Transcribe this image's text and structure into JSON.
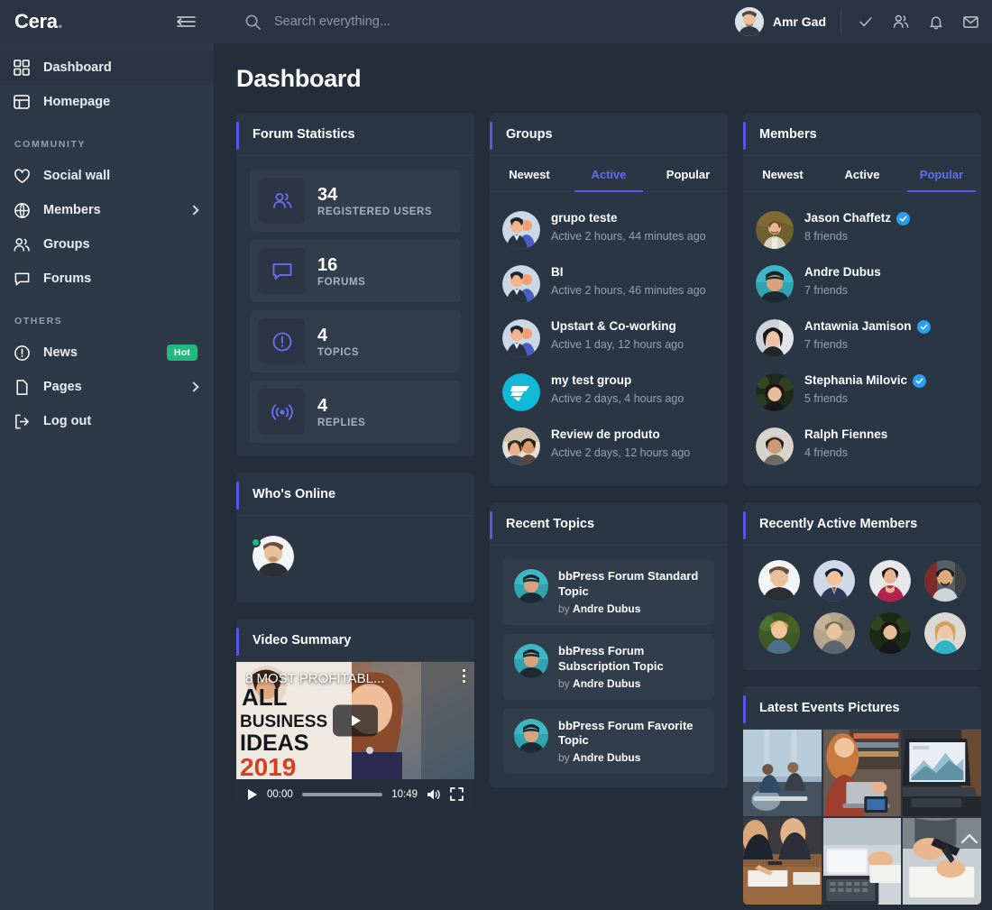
{
  "sidebar": {
    "logo": "Cera",
    "logo_dot": ".",
    "collapse_icon": "collapse-menu-icon",
    "top_items": [
      {
        "label": "Dashboard",
        "icon": "grid-icon",
        "active": true
      },
      {
        "label": "Homepage",
        "icon": "layout-icon",
        "active": false
      }
    ],
    "community_title": "COMMUNITY",
    "community_items": [
      {
        "label": "Social wall",
        "icon": "heart-icon",
        "chevron": false
      },
      {
        "label": "Members",
        "icon": "globe-icon",
        "chevron": true
      },
      {
        "label": "Groups",
        "icon": "users-icon",
        "chevron": false
      },
      {
        "label": "Forums",
        "icon": "chat-icon",
        "chevron": false
      }
    ],
    "others_title": "OTHERS",
    "others_items": [
      {
        "label": "News",
        "icon": "alert-circle-icon",
        "badge": "Hot",
        "chevron": false
      },
      {
        "label": "Pages",
        "icon": "file-icon",
        "badge": "",
        "chevron": true
      },
      {
        "label": "Log out",
        "icon": "logout-icon",
        "badge": "",
        "chevron": false
      }
    ]
  },
  "topbar": {
    "search_placeholder": "Search everything...",
    "search_value": "",
    "search_icon": "search-icon",
    "user_name": "Amr Gad",
    "icons": [
      "check-icon",
      "friends-icon",
      "bell-icon",
      "mail-icon"
    ]
  },
  "page": {
    "title": "Dashboard"
  },
  "forum_statistics": {
    "title": "Forum Statistics",
    "stats": [
      {
        "value": "34",
        "label": "REGISTERED USERS",
        "icon": "users-stat-icon"
      },
      {
        "value": "16",
        "label": "FORUMS",
        "icon": "forum-stat-icon"
      },
      {
        "value": "4",
        "label": "TOPICS",
        "icon": "topic-stat-icon"
      },
      {
        "value": "4",
        "label": "REPLIES",
        "icon": "reply-stat-icon"
      }
    ]
  },
  "whos_online": {
    "title": "Who's Online",
    "members": [
      {
        "name": "online-member-1",
        "status": "online"
      }
    ]
  },
  "video_summary": {
    "title": "Video Summary",
    "video_title": "8 MOST PROFITABL...",
    "overlay_text_1": "SMALL",
    "overlay_text_2": "BUSINESS",
    "overlay_text_3": "IDEAS",
    "overlay_text_4": "2019",
    "current_time": "00:00",
    "duration": "10:49"
  },
  "groups": {
    "title": "Groups",
    "tabs": [
      {
        "label": "Newest",
        "active": false
      },
      {
        "label": "Active",
        "active": true
      },
      {
        "label": "Popular",
        "active": false
      }
    ],
    "items": [
      {
        "name": "grupo teste",
        "meta": "Active 2 hours, 44 minutes ago",
        "avatar": "group-avatar-people"
      },
      {
        "name": "BI",
        "meta": "Active 2 hours, 46 minutes ago",
        "avatar": "group-avatar-people"
      },
      {
        "name": "Upstart & Co-working",
        "meta": "Active 1 day, 12 hours ago",
        "avatar": "group-avatar-people"
      },
      {
        "name": "my test group",
        "meta": "Active 2 days, 4 hours ago",
        "avatar": "group-avatar-logo"
      },
      {
        "name": "Review de produto",
        "meta": "Active 2 days, 12 hours ago",
        "avatar": "group-avatar-couple"
      }
    ]
  },
  "recent_topics": {
    "title": "Recent Topics",
    "items": [
      {
        "title": "bbPress Forum Standard Topic",
        "by_prefix": "by",
        "author": "Andre Dubus"
      },
      {
        "title": "bbPress Forum Subscription Topic",
        "by_prefix": "by",
        "author": "Andre Dubus"
      },
      {
        "title": "bbPress Forum Favorite Topic",
        "by_prefix": "by",
        "author": "Andre Dubus"
      }
    ]
  },
  "members": {
    "title": "Members",
    "tabs": [
      {
        "label": "Newest",
        "active": false
      },
      {
        "label": "Active",
        "active": false
      },
      {
        "label": "Popular",
        "active": true
      }
    ],
    "items": [
      {
        "name": "Jason Chaffetz",
        "friends": "8 friends",
        "verified": true
      },
      {
        "name": "Andre Dubus",
        "friends": "7 friends",
        "verified": false
      },
      {
        "name": "Antawnia Jamison",
        "friends": "7 friends",
        "verified": true
      },
      {
        "name": "Stephania Milovic",
        "friends": "5 friends",
        "verified": true
      },
      {
        "name": "Ralph Fiennes",
        "friends": "4 friends",
        "verified": false
      }
    ]
  },
  "recently_active_members": {
    "title": "Recently Active Members",
    "avatars": [
      "member-1",
      "member-2",
      "member-3",
      "member-4",
      "member-5",
      "member-6",
      "member-7",
      "member-8"
    ]
  },
  "latest_events_pictures": {
    "title": "Latest Events Pictures",
    "pictures": [
      "event-photo-1",
      "event-photo-2",
      "event-photo-3",
      "event-photo-4",
      "event-photo-5",
      "event-photo-6"
    ]
  },
  "scroll_top": {
    "icon": "chevron-up-icon"
  },
  "colors": {
    "background": "#242e3a",
    "sidebar": "#2e3947",
    "card": "#2b3644",
    "accent": "#5a55e8",
    "tab_active": "#5e6ef2",
    "badge_hot": "#1fb981",
    "verified": "#2a9df4",
    "stat_icon": "#6c6ff5"
  }
}
